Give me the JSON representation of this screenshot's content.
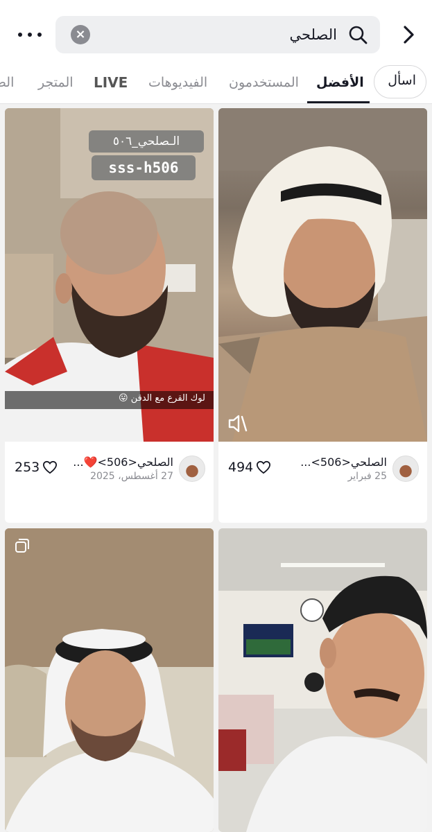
{
  "search": {
    "query": "الصلحي"
  },
  "tabs": [
    {
      "label": "اسأل"
    },
    {
      "label": "الأفضل"
    },
    {
      "label": "المستخدمون"
    },
    {
      "label": "الفيديوهات"
    },
    {
      "label": "LIVE"
    },
    {
      "label": "المتجر"
    },
    {
      "label": "الص"
    }
  ],
  "cards": [
    {
      "author": "الصلحي<506>...",
      "date": "25 فبراير",
      "likes": "494"
    },
    {
      "author": "الصلحي<506>❤️...",
      "date": "27 أغسطس، 2025",
      "likes": "253",
      "overlay_name": "الـصلحي_٥٠٦",
      "overlay_handle": "sss-h506",
      "caption": "لوك القرع مع الدقن 😛"
    },
    {
      "author": "",
      "date": "",
      "likes": ""
    },
    {
      "author": "",
      "date": "",
      "likes": ""
    }
  ],
  "icons": {
    "back": "chevron-right-icon",
    "search": "search-icon",
    "clear": "close-icon",
    "more": "more-icon",
    "heart": "heart-icon",
    "mute": "speaker-muted-icon",
    "photo": "photo-carousel-icon"
  }
}
